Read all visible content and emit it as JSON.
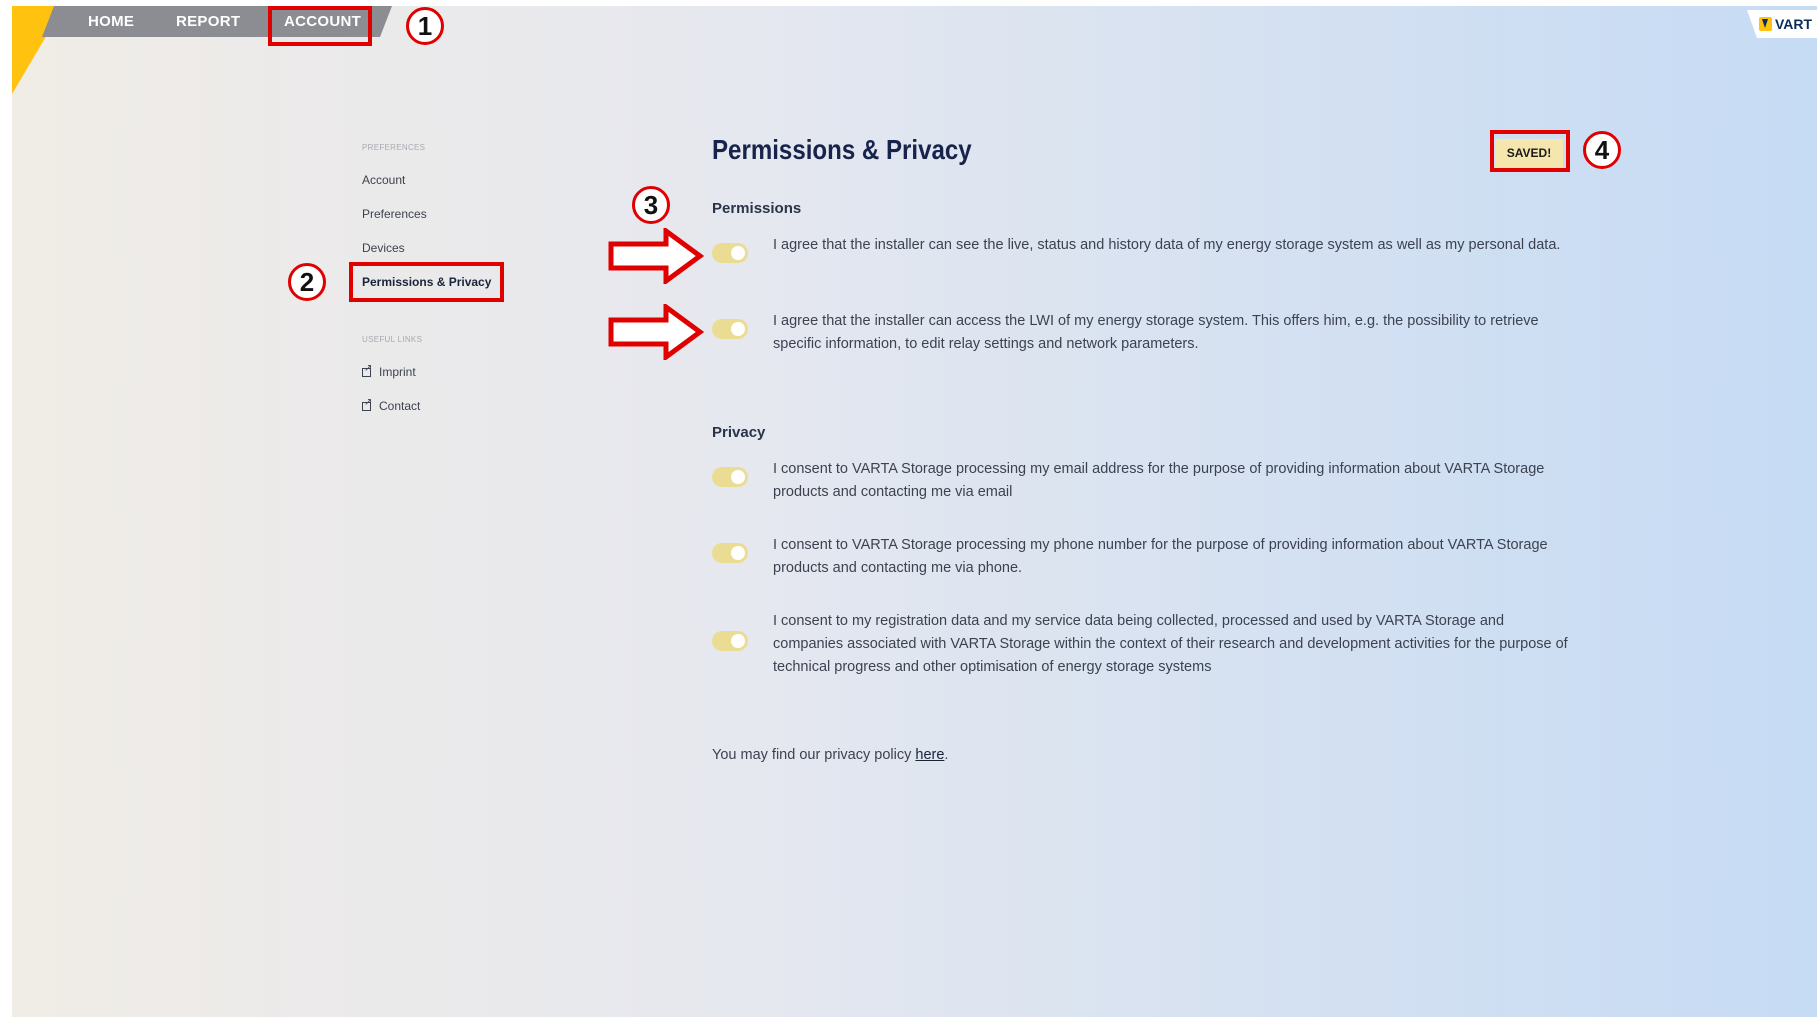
{
  "nav": {
    "items": [
      "HOME",
      "REPORT",
      "ACCOUNT"
    ]
  },
  "brand": {
    "logo_text": "VART"
  },
  "sidebar": {
    "preferences_caption": "PREFERENCES",
    "items": [
      "Account",
      "Preferences",
      "Devices",
      "Permissions & Privacy"
    ],
    "useful_links_caption": "USEFUL LINKS",
    "links": [
      "Imprint",
      "Contact"
    ]
  },
  "main": {
    "title": "Permissions & Privacy",
    "saved_label": "SAVED!",
    "permissions": {
      "heading": "Permissions",
      "items": [
        "I agree that the installer can see the live, status and history data of my energy storage system as well as my personal data.",
        "I agree that the installer can access the LWI of my energy storage system. This offers him, e.g. the possibility to retrieve specific information, to edit relay settings and network parameters."
      ]
    },
    "privacy": {
      "heading": "Privacy",
      "items": [
        "I consent to VARTA Storage processing my email address for the purpose of providing information about VARTA Storage products and contacting me via email",
        "I consent to VARTA Storage processing my phone number for the purpose of providing information about VARTA Storage products and contacting me via phone.",
        "I consent to my registration data and my service data being collected, processed and used by VARTA Storage and companies associated with VARTA Storage within the context of their research and development activities for the purpose of technical progress and other optimisation of energy storage systems"
      ]
    },
    "policy": {
      "prefix": "You may find our privacy policy ",
      "link": "here",
      "suffix": "."
    }
  },
  "annotations": {
    "markers": [
      "1",
      "2",
      "3",
      "4"
    ]
  },
  "toggles": {
    "states": [
      true,
      true,
      true,
      true,
      true
    ]
  },
  "colors": {
    "accent_yellow": "#ffc20e",
    "highlight_red": "#e00000",
    "toggle_on": "#ebdc93",
    "saved_bg": "#f5e6ae"
  }
}
